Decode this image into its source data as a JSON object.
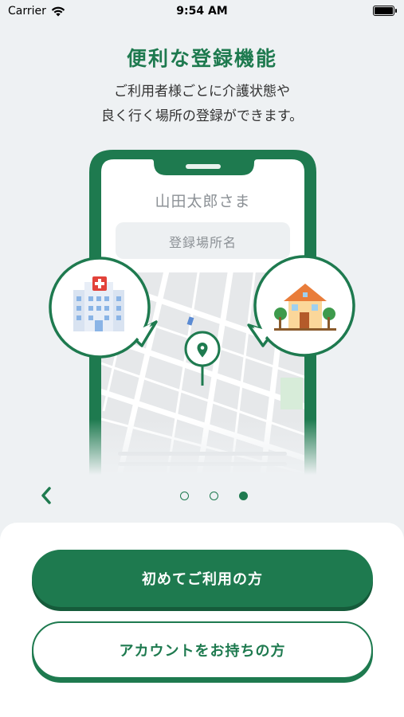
{
  "status_bar": {
    "carrier": "Carrier",
    "time": "9:54 AM"
  },
  "header": {
    "title": "便利な登録機能",
    "subtitle_line1": "ご利用者様ごとに介護状態や",
    "subtitle_line2": "良く行く場所の登録ができます。"
  },
  "phone_mock": {
    "user_name": "山田太郎さま",
    "place_input_placeholder": "登録場所名"
  },
  "carousel": {
    "page_count": 3,
    "current_page": 3
  },
  "buttons": {
    "first_time_label": "初めてご利用の方",
    "has_account_label": "アカウントをお持ちの方"
  },
  "colors": {
    "accent": "#1e7a4f",
    "background": "#eef1f3"
  }
}
